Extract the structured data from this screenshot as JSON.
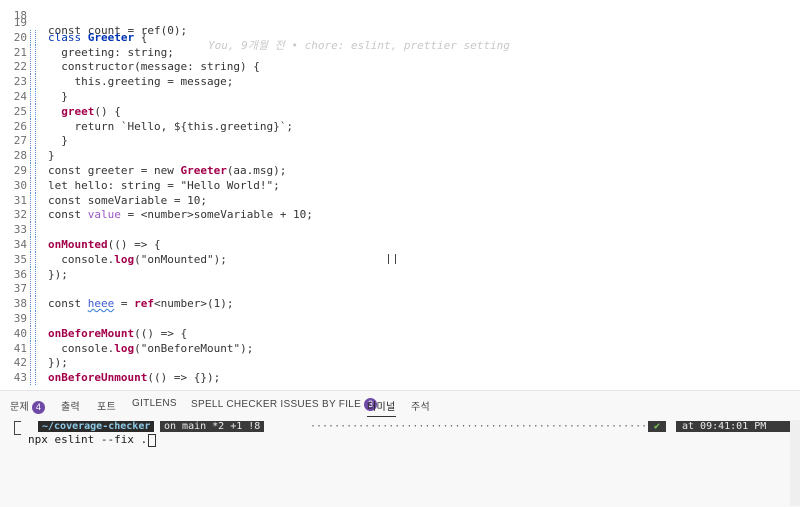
{
  "editor": {
    "lines": [
      {
        "n": "19",
        "parts": []
      },
      {
        "n": "20",
        "parts": [
          [
            "kw",
            "class "
          ],
          [
            "cls",
            "Greeter"
          ],
          [
            "plain",
            " {"
          ]
        ]
      },
      {
        "n": "21",
        "parts": [
          [
            "plain",
            "  greeting: string;"
          ]
        ]
      },
      {
        "n": "22",
        "parts": [
          [
            "plain",
            "  constructor(message: string) {"
          ]
        ]
      },
      {
        "n": "23",
        "parts": [
          [
            "plain",
            "    this.greeting = message;"
          ]
        ]
      },
      {
        "n": "24",
        "parts": [
          [
            "plain",
            "  }"
          ]
        ]
      },
      {
        "n": "25",
        "parts": [
          [
            "plain",
            "  "
          ],
          [
            "fn",
            "greet"
          ],
          [
            "plain",
            "() {"
          ]
        ]
      },
      {
        "n": "26",
        "parts": [
          [
            "plain",
            "    return `Hello, ${this.greeting}`;"
          ]
        ]
      },
      {
        "n": "27",
        "parts": [
          [
            "plain",
            "  }"
          ]
        ]
      },
      {
        "n": "28",
        "parts": [
          [
            "plain",
            "}"
          ]
        ]
      },
      {
        "n": "29",
        "parts": [
          [
            "plain",
            "const greeter = new "
          ],
          [
            "fn",
            "Greeter"
          ],
          [
            "plain",
            "(aa.msg);"
          ]
        ]
      },
      {
        "n": "30",
        "parts": [
          [
            "plain",
            "let hello: string = \"Hello World!\";"
          ]
        ]
      },
      {
        "n": "31",
        "parts": [
          [
            "plain",
            "const someVariable = 10;"
          ]
        ]
      },
      {
        "n": "32",
        "parts": [
          [
            "plain",
            "const "
          ],
          [
            "vue",
            "value"
          ],
          [
            "plain",
            " = <number>someVariable + 10;"
          ]
        ]
      },
      {
        "n": "33",
        "parts": []
      },
      {
        "n": "34",
        "parts": [
          [
            "fn",
            "onMounted"
          ],
          [
            "plain",
            "(() => {"
          ]
        ]
      },
      {
        "n": "35",
        "parts": [
          [
            "plain",
            "  console."
          ],
          [
            "fn",
            "log"
          ],
          [
            "plain",
            "(\"onMounted\");"
          ]
        ]
      },
      {
        "n": "36",
        "parts": [
          [
            "plain",
            "});"
          ]
        ]
      },
      {
        "n": "37",
        "parts": []
      },
      {
        "n": "38",
        "parts": [
          [
            "plain",
            "const "
          ],
          [
            "err",
            "heee"
          ],
          [
            "plain",
            " = "
          ],
          [
            "fn",
            "ref"
          ],
          [
            "plain",
            "<number>(1);"
          ]
        ]
      },
      {
        "n": "39",
        "parts": []
      },
      {
        "n": "40",
        "parts": [
          [
            "fn",
            "onBeforeMount"
          ],
          [
            "plain",
            "(() => {"
          ]
        ]
      },
      {
        "n": "41",
        "parts": [
          [
            "plain",
            "  console."
          ],
          [
            "fn",
            "log"
          ],
          [
            "plain",
            "(\"onBeforeMount\");"
          ]
        ]
      },
      {
        "n": "42",
        "parts": [
          [
            "plain",
            "});"
          ]
        ]
      },
      {
        "n": "43",
        "parts": [
          [
            "fn",
            "onBeforeUnmount"
          ],
          [
            "plain",
            "(() => {});"
          ]
        ]
      }
    ],
    "top_partial": {
      "n": "18",
      "code": "const count = ref(0);",
      "blame": "You, 9개월 전 • chore: eslint, prettier setting"
    }
  },
  "panel": {
    "tabs": [
      {
        "label": "문제",
        "badge": "4"
      },
      {
        "label": "출력"
      },
      {
        "label": "포트"
      },
      {
        "label": "GITLENS"
      },
      {
        "label": "SPELL CHECKER ISSUES BY FILE",
        "badge": "3"
      },
      {
        "label": "터미널",
        "active": true
      },
      {
        "label": "주석"
      }
    ],
    "terminal": {
      "path": "~/coverage-checker",
      "branch": "on main *2 +1 !8",
      "check": "✔",
      "time": "at 09:41:01 PM",
      "command": "npx eslint --fix ."
    }
  }
}
